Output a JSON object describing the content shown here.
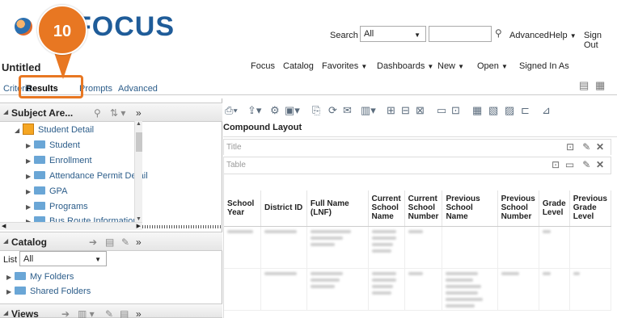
{
  "header": {
    "logo_text": "FOCUS",
    "search_label": "Search",
    "search_scope": "All",
    "advanced_label": "Advanced",
    "help_label": "Help",
    "signout_label": "Sign Out"
  },
  "badge": {
    "number": "10"
  },
  "title_bar": {
    "title": "Untitled",
    "links": [
      "Focus",
      "Catalog",
      "Favorites",
      "Dashboards",
      "New",
      "Open",
      "Signed In As"
    ]
  },
  "tabs": [
    "Criteria",
    "Results",
    "Prompts",
    "Advanced"
  ],
  "subject_areas": {
    "title": "Subject Are...",
    "root": "Student Detail",
    "folders": [
      "Student",
      "Enrollment",
      "Attendance Permit Detail",
      "GPA",
      "Programs",
      "Bus Route Information"
    ]
  },
  "catalog": {
    "title": "Catalog",
    "list_label": "List",
    "list_value": "All",
    "folders": [
      "My Folders",
      "Shared Folders"
    ]
  },
  "views_panel": {
    "title": "Views"
  },
  "results": {
    "compound_layout": "Compound Layout",
    "title_view": "Title",
    "table_view": "Table",
    "columns": [
      "School Year",
      "District ID",
      "Full Name (LNF)",
      "Current School Name",
      "Current School Number",
      "Previous School Name",
      "Previous School Number",
      "Grade Level",
      "Previous Grade Level"
    ]
  },
  "colors": {
    "accent": "#e87722",
    "link": "#2c5d8a",
    "brand": "#1f5c99"
  },
  "icons": [
    "search-icon",
    "sort-icon",
    "expand-icon",
    "print-icon",
    "export-icon",
    "edit-icon",
    "close-icon"
  ]
}
